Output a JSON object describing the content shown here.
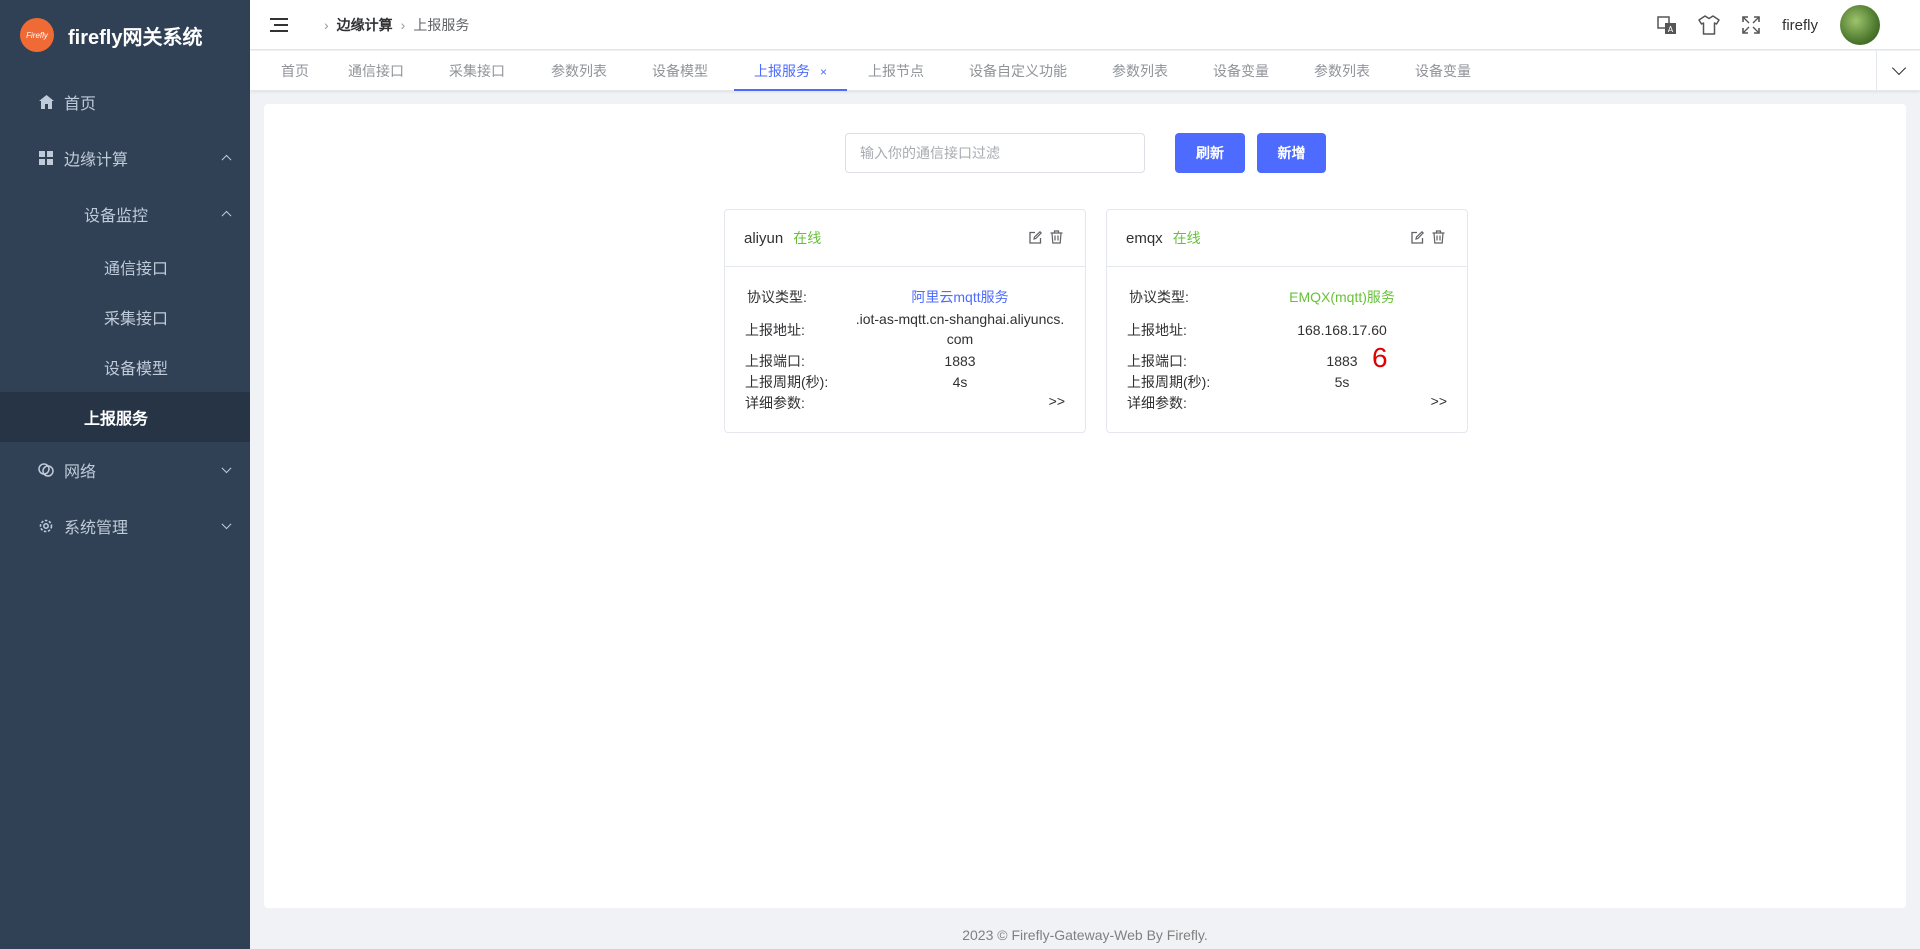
{
  "app": {
    "title": "firefly网关系统",
    "logo_text": "Firefly"
  },
  "sidebar": {
    "home": "首页",
    "edge": "边缘计算",
    "device_monitor": "设备监控",
    "comm_port": "通信接口",
    "collect_port": "采集接口",
    "device_model": "设备模型",
    "report_service": "上报服务",
    "network": "网络",
    "system": "系统管理"
  },
  "breadcrumb": {
    "level1": "边缘计算",
    "level2": "上报服务"
  },
  "header": {
    "username": "firefly"
  },
  "tags": [
    "首页",
    "通信接口",
    "采集接口",
    "参数列表",
    "设备模型",
    "上报服务",
    "上报节点",
    "设备自定义功能",
    "参数列表",
    "设备变量",
    "参数列表",
    "设备变量"
  ],
  "tag_close": "×",
  "search": {
    "placeholder": "输入你的通信接口过滤",
    "value": ""
  },
  "buttons": {
    "refresh": "刷新",
    "add": "新增"
  },
  "labels": {
    "protocol": "协议类型:",
    "address": "上报地址:",
    "port": "上报端口:",
    "period": "上报周期(秒):",
    "details": "详细参数:",
    "more": ">>"
  },
  "cards": [
    {
      "name": "aliyun",
      "status": "在线",
      "protocol": "阿里云mqtt服务",
      "address": ".iot-as-mqtt.cn-shanghai.aliyuncs.com",
      "port": "1883",
      "period": "4s"
    },
    {
      "name": "emqx",
      "status": "在线",
      "protocol": "EMQX(mqtt)服务",
      "address": "168.168.17.60",
      "port": "1883",
      "period": "5s"
    }
  ],
  "marker": "6",
  "footer": "2023 © Firefly-Gateway-Web By Firefly.",
  "colors": {
    "sidebar_bg": "#304156",
    "primary": "#4d6bfe",
    "online": "#67c23a"
  }
}
